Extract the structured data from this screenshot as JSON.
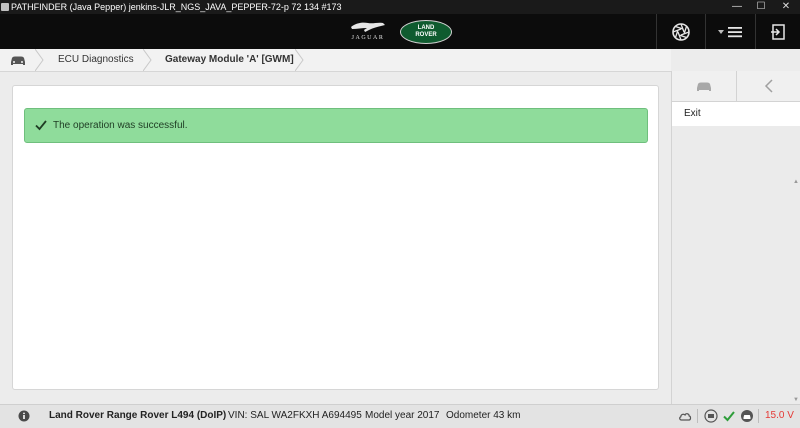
{
  "window": {
    "title": "PATHFINDER (Java Pepper) jenkins-JLR_NGS_JAVA_PEPPER-72-p 72 134 #173"
  },
  "header": {
    "brand_left": "JAGUAR",
    "brand_right_line1": "LAND",
    "brand_right_line2": "ROVER",
    "icons": [
      "aperture-icon",
      "menu-icon",
      "logout-icon"
    ]
  },
  "breadcrumb": {
    "items": [
      "ECU Diagnostics",
      "Gateway Module 'A' [GWM]"
    ]
  },
  "alert": {
    "message": "The operation was successful."
  },
  "right_panel": {
    "exit_label": "Exit"
  },
  "status_bar": {
    "vehicle": "Land Rover Range Rover L494 (DoIP)",
    "vin": "VIN: SAL WA2FKXH A694495",
    "model_year": "Model year 2017",
    "odometer": "Odometer 43 km",
    "voltage": "15.0 V"
  },
  "colors": {
    "success_bg": "#8fdc9b",
    "voltage": "#e53935",
    "header_bg": "#0c0c0c"
  }
}
